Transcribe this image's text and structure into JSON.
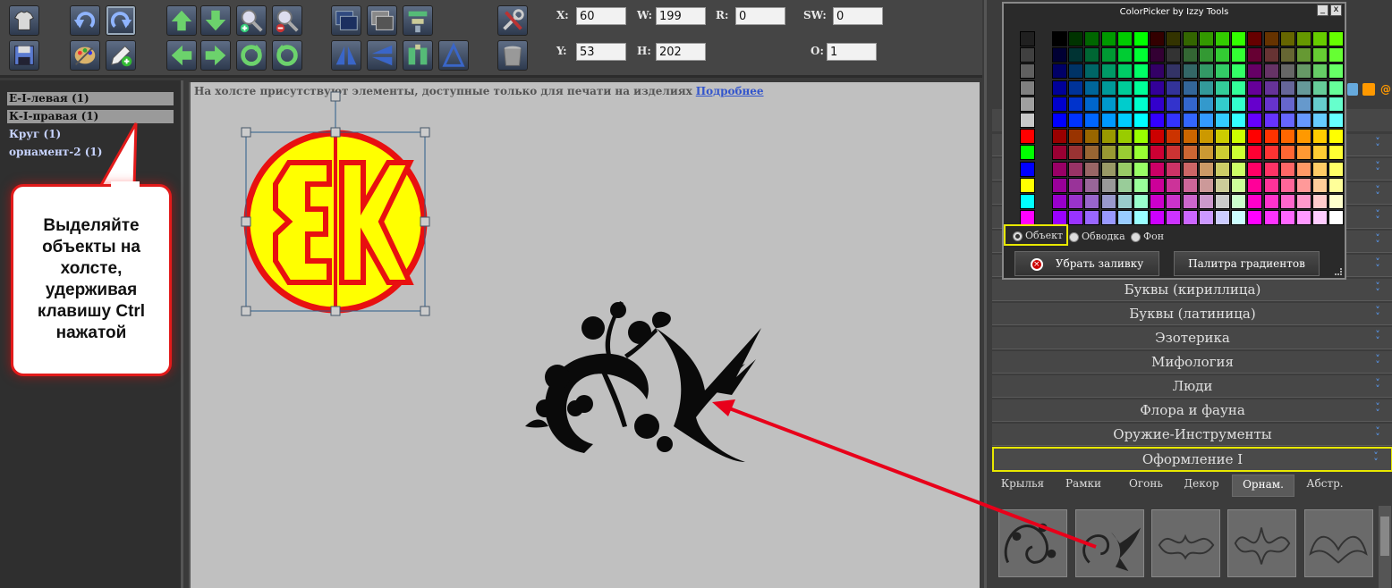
{
  "toolbar": {
    "fields": {
      "x_label": "X:",
      "x_value": "60",
      "w_label": "W:",
      "w_value": "199",
      "r_label": "R:",
      "r_value": "0",
      "sw_label": "SW:",
      "sw_value": "0",
      "y_label": "Y:",
      "y_value": "53",
      "h_label": "H:",
      "h_value": "202",
      "o_label": "O:",
      "o_value": "1"
    }
  },
  "layers": [
    {
      "label": "Е-I-левая (1)",
      "selected": true
    },
    {
      "label": "К-I-правая (1)",
      "selected": true
    },
    {
      "label": "Круг (1)",
      "selected": false
    },
    {
      "label": "орнамент-2 (1)",
      "selected": false
    }
  ],
  "callout": {
    "text": "Выделяйте объекты на холсте, удерживая клавишу Ctrl нажатой"
  },
  "canvas": {
    "notice": "На холсте присутствуют элементы, доступные только для печати на изделиях",
    "notice_link": "Подробнее",
    "monogram": {
      "left_letter": "Ɛ",
      "right_letter": "K",
      "fill": "#ffff00",
      "stroke": "#e81010"
    }
  },
  "picker": {
    "title": "ColorPicker by Izzy Tools",
    "minimize": "_",
    "close": "x",
    "radio_object": "Объект",
    "radio_stroke": "Обводка",
    "radio_background": "Фон",
    "remove_fill": "Убрать заливку",
    "gradient_palette": "Палитра градиентов"
  },
  "categories": [
    {
      "label": "Буквы (кириллица)"
    },
    {
      "label": "Буквы (латиница)"
    },
    {
      "label": "Эзотерика"
    },
    {
      "label": "Мифология"
    },
    {
      "label": "Люди"
    },
    {
      "label": "Флора и фауна"
    },
    {
      "label": "Оружие-Инструменты"
    },
    {
      "label": "Оформление I",
      "active": true
    }
  ],
  "subtabs": [
    "Крылья",
    "Рамки",
    "Огонь",
    "Декор",
    "Орнам.",
    "Абстр."
  ],
  "active_subtab": "Орнам.",
  "colors": {
    "accent": "#e8e800",
    "annotation": "#e21a1a",
    "canvas": "#c0c0c0"
  }
}
